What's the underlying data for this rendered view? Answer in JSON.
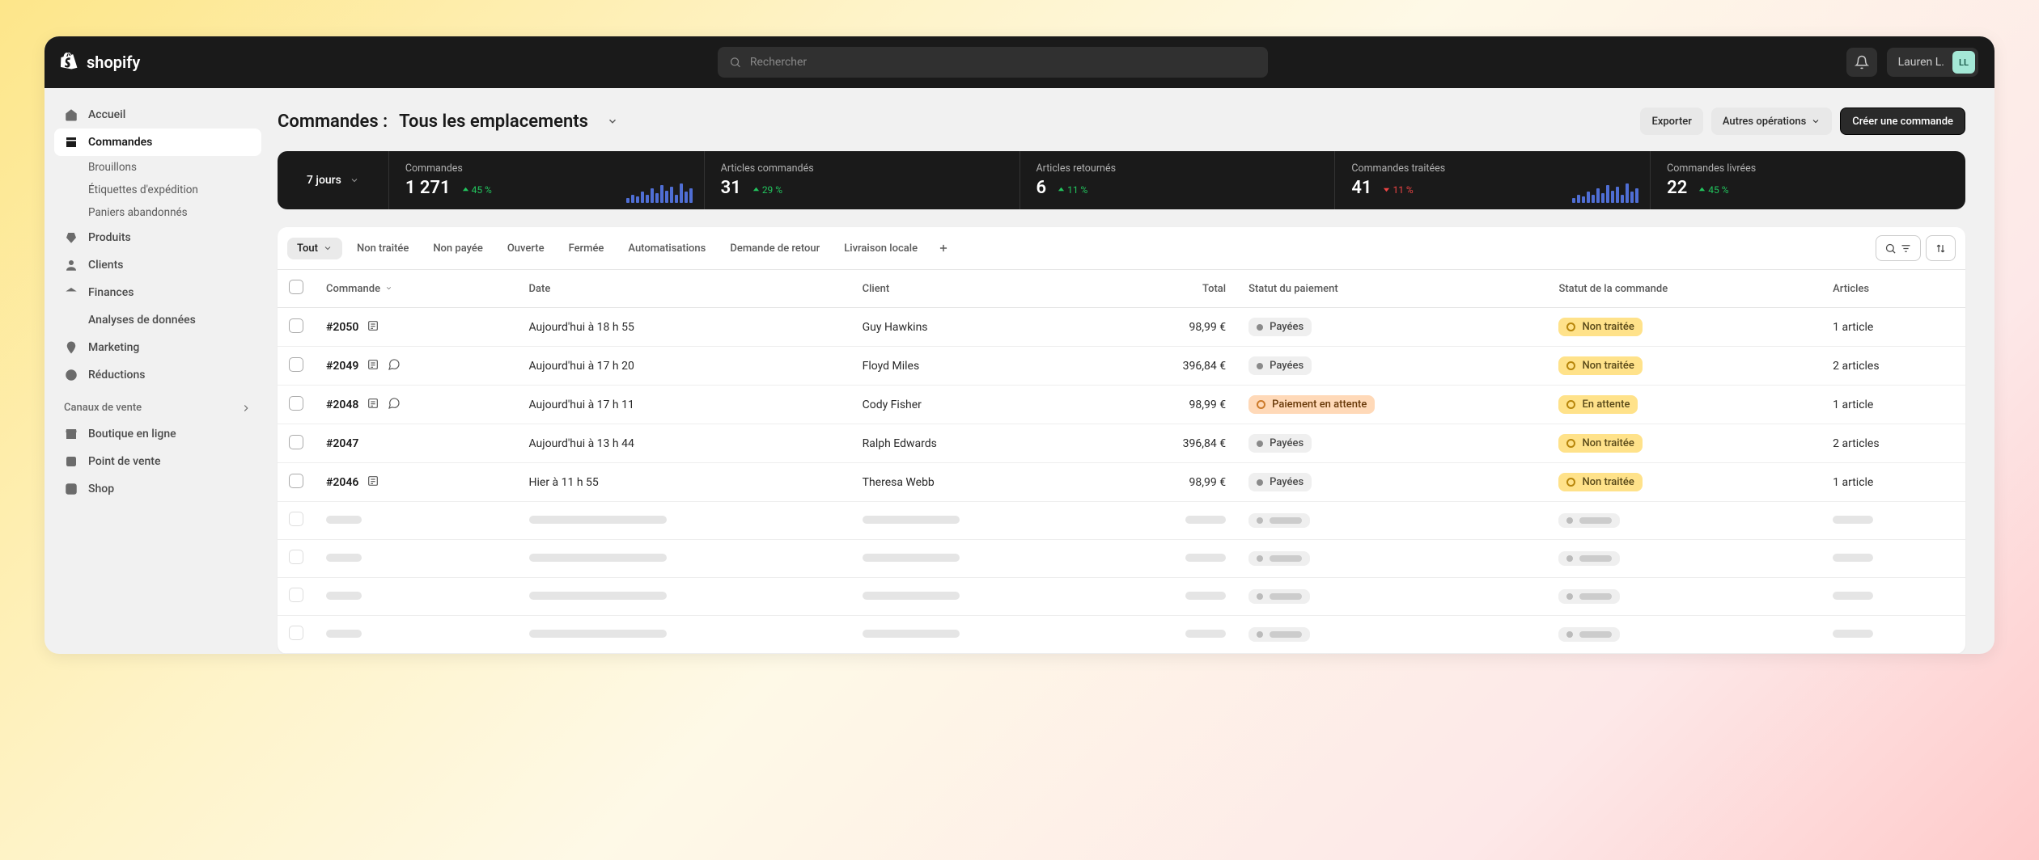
{
  "brand": "shopify",
  "search": {
    "placeholder": "Rechercher"
  },
  "user": {
    "name": "Lauren L.",
    "initials": "LL"
  },
  "sidebar": {
    "items": [
      {
        "label": "Accueil"
      },
      {
        "label": "Commandes"
      },
      {
        "label": "Produits"
      },
      {
        "label": "Clients"
      },
      {
        "label": "Finances"
      },
      {
        "label": "Analyses de données"
      },
      {
        "label": "Marketing"
      },
      {
        "label": "Réductions"
      }
    ],
    "orders_sub": [
      {
        "label": "Brouillons"
      },
      {
        "label": "Étiquettes d'expédition"
      },
      {
        "label": "Paniers abandonnés"
      }
    ],
    "channels_header": "Canaux de vente",
    "channels": [
      {
        "label": "Boutique en ligne"
      },
      {
        "label": "Point de vente"
      },
      {
        "label": "Shop"
      }
    ]
  },
  "header": {
    "title_prefix": "Commandes :",
    "title_location": "Tous les emplacements",
    "export": "Exporter",
    "more": "Autres opérations",
    "create": "Créer une commande"
  },
  "stats": {
    "period": "7 jours",
    "cards": [
      {
        "label": "Commandes",
        "value": "1 271",
        "delta": "45 %",
        "dir": "up",
        "spark": true
      },
      {
        "label": "Articles commandés",
        "value": "31",
        "delta": "29 %",
        "dir": "up"
      },
      {
        "label": "Articles retournés",
        "value": "6",
        "delta": "11 %",
        "dir": "up"
      },
      {
        "label": "Commandes traitées",
        "value": "41",
        "delta": "11 %",
        "dir": "down",
        "spark": true
      },
      {
        "label": "Commandes livrées",
        "value": "22",
        "delta": "45 %",
        "dir": "up"
      }
    ]
  },
  "tabs": [
    "Tout",
    "Non traitée",
    "Non payée",
    "Ouverte",
    "Fermée",
    "Automatisations",
    "Demande de retour",
    "Livraison locale"
  ],
  "columns": {
    "order": "Commande",
    "date": "Date",
    "customer": "Client",
    "total": "Total",
    "payment": "Statut du paiement",
    "fulfillment": "Statut de la commande",
    "items": "Articles"
  },
  "rows": [
    {
      "id": "#2050",
      "icons": [
        "note"
      ],
      "date": "Aujourd'hui à 18 h 55",
      "customer": "Guy Hawkins",
      "total": "98,99 €",
      "payment": "Payées",
      "payment_style": "grey",
      "fulfillment": "Non traitée",
      "fulfillment_style": "yellow",
      "items": "1 article"
    },
    {
      "id": "#2049",
      "icons": [
        "note",
        "chat"
      ],
      "date": "Aujourd'hui à 17 h 20",
      "customer": "Floyd Miles",
      "total": "396,84 €",
      "payment": "Payées",
      "payment_style": "grey",
      "fulfillment": "Non traitée",
      "fulfillment_style": "yellow",
      "items": "2 articles"
    },
    {
      "id": "#2048",
      "icons": [
        "note",
        "chat"
      ],
      "date": "Aujourd'hui à 17 h 11",
      "customer": "Cody Fisher",
      "total": "98,99 €",
      "payment": "Paiement en attente",
      "payment_style": "orange",
      "fulfillment": "En attente",
      "fulfillment_style": "yellow",
      "items": "1 article"
    },
    {
      "id": "#2047",
      "icons": [],
      "date": "Aujourd'hui à 13 h 44",
      "customer": "Ralph Edwards",
      "total": "396,84 €",
      "payment": "Payées",
      "payment_style": "grey",
      "fulfillment": "Non traitée",
      "fulfillment_style": "yellow",
      "items": "2 articles"
    },
    {
      "id": "#2046",
      "icons": [
        "note"
      ],
      "date": "Hier à 11 h 55",
      "customer": "Theresa Webb",
      "total": "98,99 €",
      "payment": "Payées",
      "payment_style": "grey",
      "fulfillment": "Non traitée",
      "fulfillment_style": "yellow",
      "items": "1 article"
    }
  ],
  "skeleton_rows": 4
}
